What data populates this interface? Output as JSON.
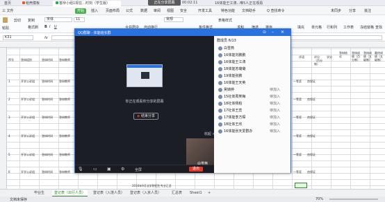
{
  "tabs": [
    {
      "label": "首页"
    },
    {
      "label": "稻壳模板"
    },
    {
      "label": "答辩小组1现在...时刻（学生版）"
    },
    {
      "label": "16体能王江涛...唯5人正在观看"
    }
  ],
  "share": {
    "banner": "正在分享屏幕",
    "time": "00:02:11"
  },
  "menu": {
    "file": "三 文件",
    "items": [
      "开始",
      "插入",
      "页面布局",
      "公式",
      "数据",
      "审阅",
      "视图",
      "安全",
      "开发工具",
      "特色功能",
      "文档助手"
    ],
    "search": "Q 查找命令",
    "right": [
      "未同步",
      "分享",
      "批注"
    ]
  },
  "ribbon": {
    "paste": "粘贴",
    "cut": "剪切",
    "copy": "复制",
    "format_painter": "格式刷",
    "font_name": "宋体",
    "font_size": "11",
    "merge": "合并居中",
    "wrap": "自动换行",
    "number_format": "常规",
    "conditional": "条件格式",
    "table_style": "表格样式",
    "sum": "求和",
    "filter": "筛选",
    "sort": "排序",
    "fill": "填充",
    "cell": "单元格",
    "row_col": "行和列",
    "worksheet": "工作表",
    "freeze": "冻结窗格",
    "table_tools": "表格工具",
    "find": "查找",
    "symbol": "符号"
  },
  "formula_bar": {
    "cell_ref": "K31",
    "fx": "fx"
  },
  "sheet": {
    "headers_left": [
      "序号",
      "答辩组别",
      "答辩时间",
      "答辩教师"
    ],
    "headers_right": [
      "评语",
      "评分（百分制）",
      "学分",
      "答辩结论",
      "答辩成绩（百分制）",
      "答辩成绩（五级制）",
      "最终成绩（五级制）"
    ],
    "rows": [
      {
        "no": "1",
        "group": "开学公诉组",
        "time": "答辩时间",
        "teacher": "答辩教师"
      },
      {
        "no": "2",
        "group": "开学公诉组",
        "time": "答辩时间",
        "teacher": "答辩教师"
      },
      {
        "no": "3",
        "group": "开学公诉组",
        "time": "答辩时间",
        "teacher": "答辩教师"
      },
      {
        "no": "4",
        "group": "开学公诉组",
        "time": "答辩时间",
        "teacher": "答辩教师"
      },
      {
        "no": "5",
        "group": "开学公诉组",
        "time": "答辩时间",
        "teacher": "答辩教师"
      },
      {
        "no": "6",
        "group": "开学公诉组",
        "time": "答辩时间",
        "teacher": "答辩教师"
      }
    ],
    "row_values": [
      "一等奖",
      "良保证"
    ],
    "bottom_note": "2016年9月法学院招生专业汇总"
  },
  "sheet_tabs": [
    "毕业生",
    "登记表（出行人员）",
    "登记表（入境人员）",
    "登记表（入京人员）",
    "汇总表",
    "Sheet1",
    "+"
  ],
  "status": {
    "left": "文档未保存",
    "zoom": "70%"
  },
  "qq": {
    "title": "QQ群聊 · 体能班长群",
    "sharing_text": "你正在观看你分享的屏幕",
    "stop_button": "结束分享",
    "collapse": "收起",
    "self_name": "白雪燕",
    "end_button": "退出",
    "fullscreen": "全屏",
    "controls": [
      "麦克风",
      "摄像头",
      "分享",
      "全屏",
      "结束"
    ],
    "members_title": "群成员 6/13",
    "members": [
      {
        "name": "白雪燕",
        "status": ""
      },
      {
        "name": "16体能刘鹏鹏",
        "status": ""
      },
      {
        "name": "16体能王江涛",
        "status": ""
      },
      {
        "name": "18体能苏璐璐",
        "status": ""
      },
      {
        "name": "19体能张鹏",
        "status": ""
      },
      {
        "name": "16体能王天英",
        "status": ""
      },
      {
        "name": "吴婧婷",
        "status": "待加入"
      },
      {
        "name": "15社体周笑梅",
        "status": "待加入"
      },
      {
        "name": "18社体杨柏",
        "status": "待加入"
      },
      {
        "name": "17社体王蕊",
        "status": "待加入"
      },
      {
        "name": "17体能李方琛",
        "status": "待加入"
      },
      {
        "name": "18社体王欣",
        "status": "待加入"
      },
      {
        "name": "16体能张天爱群办",
        "status": "待加入"
      }
    ]
  },
  "colors": {
    "accent": "#2a72e0",
    "green": "#4fae4f",
    "end_red": "#e0392b"
  }
}
